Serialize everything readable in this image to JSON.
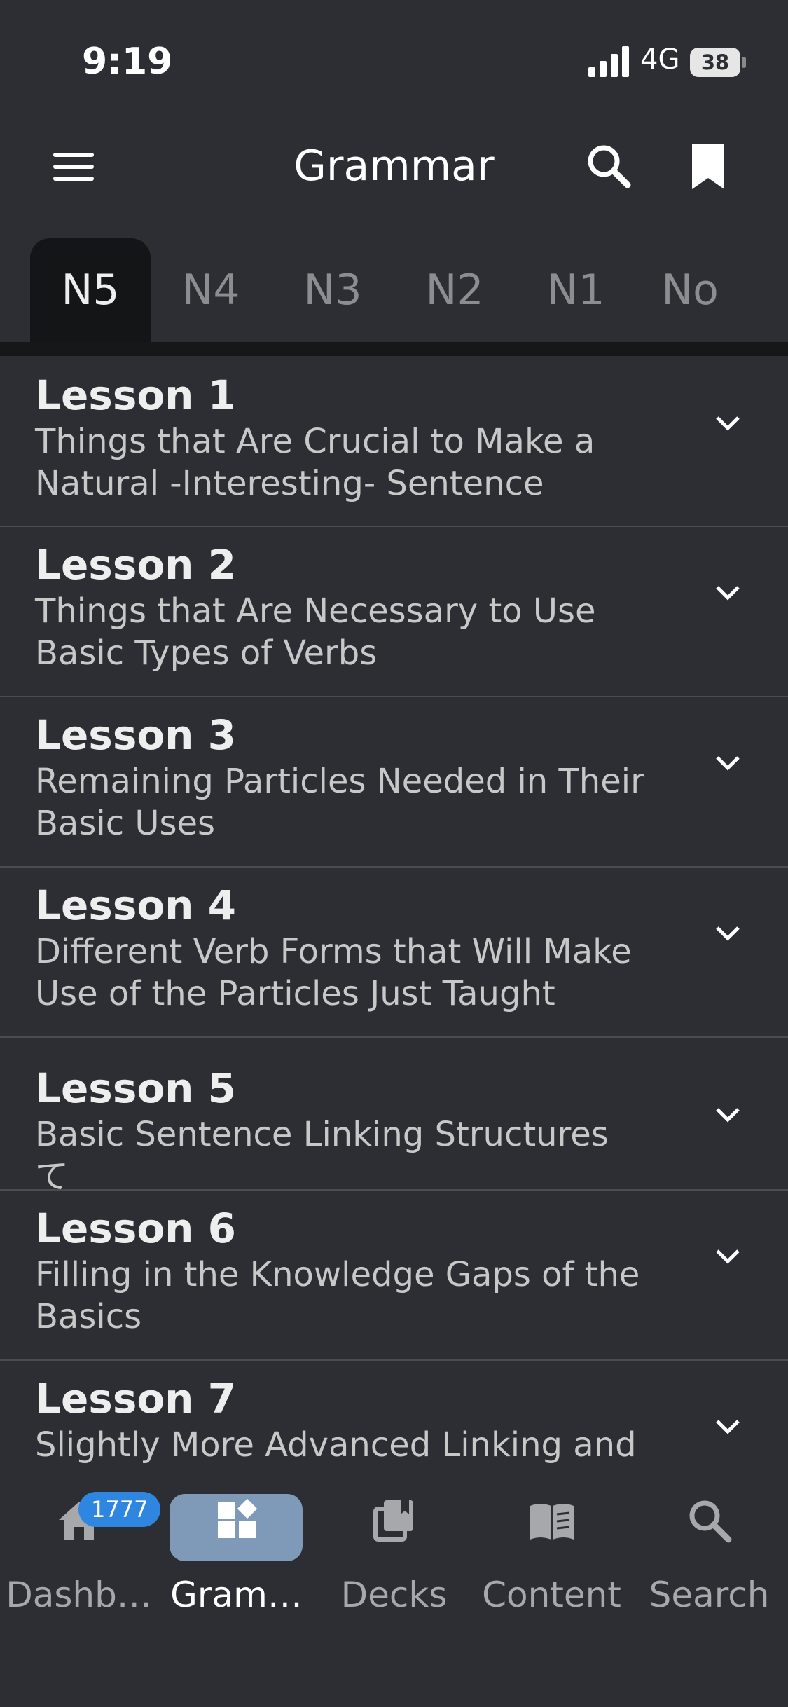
{
  "status_bar": {
    "time": "9:19",
    "network": "4G",
    "battery": "38"
  },
  "header": {
    "title": "Grammar"
  },
  "tabs": [
    {
      "label": "N5",
      "active": true
    },
    {
      "label": "N4",
      "active": false
    },
    {
      "label": "N3",
      "active": false
    },
    {
      "label": "N2",
      "active": false
    },
    {
      "label": "N1",
      "active": false
    },
    {
      "label": "No",
      "active": false
    }
  ],
  "lessons": [
    {
      "title": "Lesson 1",
      "subtitle": "Things that Are Crucial to Make a Natural -Interesting- Sentence"
    },
    {
      "title": "Lesson 2",
      "subtitle": "Things that Are Necessary to Use Basic Types of Verbs"
    },
    {
      "title": "Lesson 3",
      "subtitle": "Remaining Particles Needed in Their Basic Uses"
    },
    {
      "title": "Lesson 4",
      "subtitle": "Different Verb Forms that Will Make Use of the Particles Just Taught"
    },
    {
      "title": "Lesson 5",
      "subtitle": "Basic Sentence Linking Structures て"
    },
    {
      "title": "Lesson 6",
      "subtitle": "Filling in the Knowledge Gaps of the Basics"
    },
    {
      "title": "Lesson 7",
      "subtitle": "Slightly More Advanced Linking and"
    }
  ],
  "bottom_nav": [
    {
      "label": "Dashb…",
      "icon": "home-icon",
      "badge": "1777"
    },
    {
      "label": "Gram…",
      "icon": "grammar-icon",
      "active": true
    },
    {
      "label": "Decks",
      "icon": "decks-icon"
    },
    {
      "label": "Content",
      "icon": "book-icon"
    },
    {
      "label": "Search",
      "icon": "search-icon"
    }
  ]
}
